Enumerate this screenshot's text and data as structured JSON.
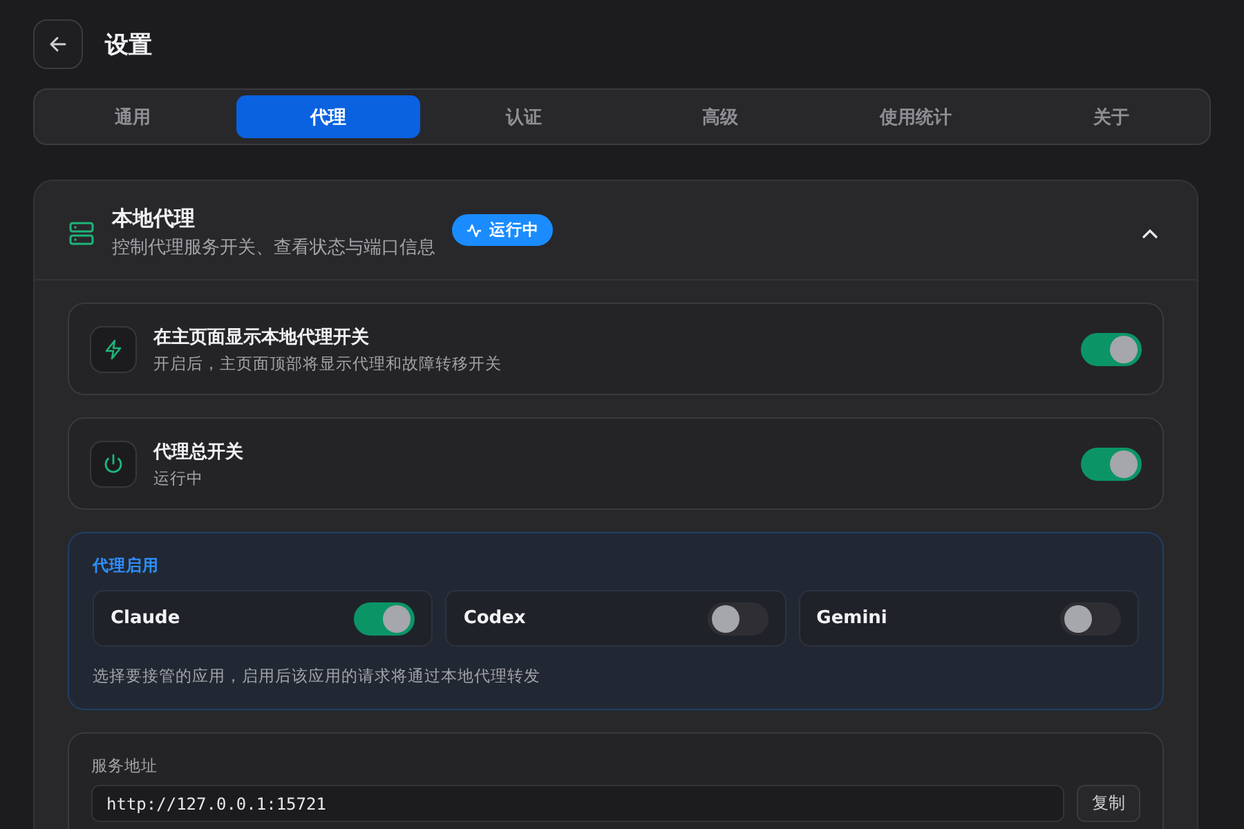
{
  "header": {
    "title": "设置"
  },
  "tabs": [
    {
      "label": "通用",
      "selected": false
    },
    {
      "label": "代理",
      "selected": true
    },
    {
      "label": "认证",
      "selected": false
    },
    {
      "label": "高级",
      "selected": false
    },
    {
      "label": "使用统计",
      "selected": false
    },
    {
      "label": "关于",
      "selected": false
    }
  ],
  "section": {
    "title": "本地代理",
    "subtitle": "控制代理服务开关、查看状态与端口信息",
    "status_badge": "运行中",
    "expanded": true
  },
  "settings": [
    {
      "kind": "display",
      "title": "在主页面显示本地代理开关",
      "description": "开启后，主页面顶部将显示代理和故障转移开关",
      "on": true
    },
    {
      "kind": "power",
      "title": "代理总开关",
      "description": "运行中",
      "on": true
    }
  ],
  "proxy_apps": {
    "title": "代理启用",
    "apps": [
      {
        "name": "Claude",
        "on": true
      },
      {
        "name": "Codex",
        "on": false
      },
      {
        "name": "Gemini",
        "on": false
      }
    ],
    "hint": "选择要接管的应用，启用后该应用的请求将通过本地代理转发"
  },
  "service_address": {
    "label": "服务地址",
    "value": "http://127.0.0.1:15721",
    "copy_button": "复制"
  }
}
